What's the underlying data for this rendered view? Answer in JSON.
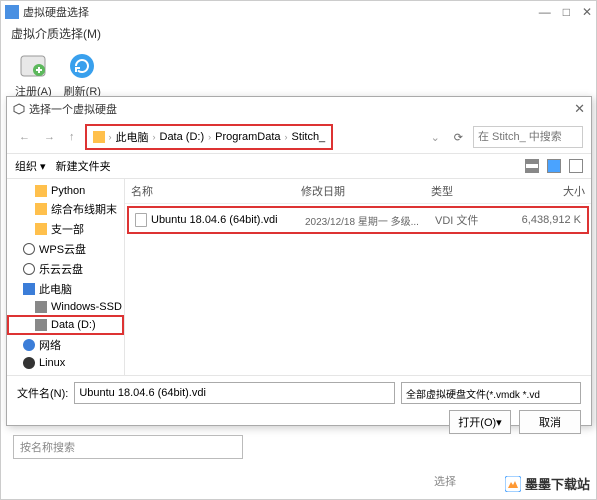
{
  "outer": {
    "title": "虚拟硬盘选择",
    "menu": "虚拟介质选择(M)"
  },
  "toolbar": {
    "register": "注册(A)",
    "refresh": "刷新(R)"
  },
  "dialog": {
    "title": "选择一个虚拟硬盘",
    "breadcrumb": {
      "pc": "此电脑",
      "d": "Data (D:)",
      "pd": "ProgramData",
      "st": "Stitch_"
    },
    "search_ph": "在 Stitch_ 中搜索",
    "organize": "组织 ▾",
    "newfolder": "新建文件夹"
  },
  "sidebar": {
    "items": [
      {
        "label": "Python",
        "cls": "folder-ico",
        "indent": 1
      },
      {
        "label": "综合布线期末",
        "cls": "folder-ico",
        "indent": 1
      },
      {
        "label": "支一部",
        "cls": "folder-ico",
        "indent": 1
      },
      {
        "label": "WPS云盘",
        "cls": "cloud-ico",
        "indent": 0
      },
      {
        "label": "乐云云盘",
        "cls": "cloud-ico",
        "indent": 0
      },
      {
        "label": "此电脑",
        "cls": "pc-ico",
        "indent": 0
      },
      {
        "label": "Windows-SSD",
        "cls": "drive-ico",
        "indent": 1
      },
      {
        "label": "Data (D:)",
        "cls": "drive-ico",
        "indent": 1,
        "sel": true
      },
      {
        "label": "网络",
        "cls": "net-ico",
        "indent": 0
      },
      {
        "label": "Linux",
        "cls": "tux-ico",
        "indent": 0
      }
    ]
  },
  "filelist": {
    "head": {
      "name": "名称",
      "date": "修改日期",
      "type": "类型",
      "size": "大小"
    },
    "row": {
      "name": "Ubuntu 18.04.6 (64bit).vdi",
      "date": "2023/12/18 星期一 多级...",
      "type": "VDI 文件",
      "size": "6,438,912 K"
    }
  },
  "bottom": {
    "fn_label": "文件名(N):",
    "fn_value": "Ubuntu 18.04.6 (64bit).vdi",
    "filter": "全部虚拟硬盘文件(*.vmdk *.vd",
    "open": "打开(O)",
    "cancel": "取消"
  },
  "footer": {
    "search_ph": "按名称搜索",
    "select": "选择",
    "brand": "墨墨下载站"
  }
}
